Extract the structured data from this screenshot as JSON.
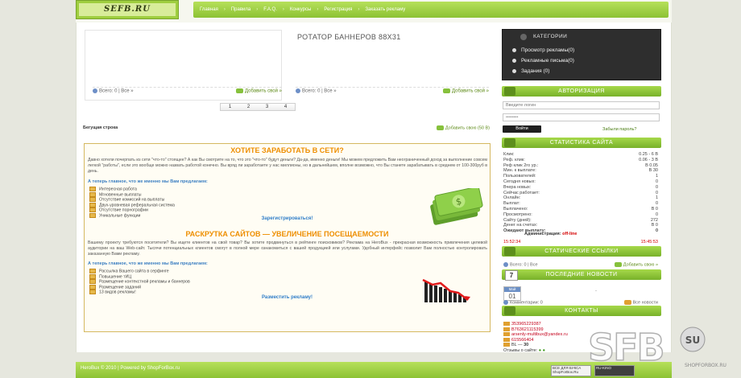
{
  "header": {
    "logo": "SEFB.RU",
    "nav": [
      "Главная",
      "Правила",
      "F.A.Q.",
      "Конкурсы",
      "Регистрация",
      "Заказать рекламу"
    ]
  },
  "banners": {
    "title": "РОТАТОР БАННЕРОВ 88X31",
    "left_count": "Всего: 0 | Все »",
    "left_add": "Добавить свой »",
    "right_count": "Всего: 0 | Все »",
    "right_add": "Добавить свой »",
    "pages": [
      "1",
      "2",
      "3",
      "4"
    ]
  },
  "ticker": {
    "label": "Бегущая строка",
    "add": "Добавить свою (50 В)"
  },
  "offer": {
    "h1": "ХОТИТЕ ЗАРАБОТАТЬ В СЕТИ?",
    "text1": "Давно хотели почерпать из сети \"что-то\" стоящее? А как Вы смотрите на то, что это \"что-то\" будут деньги? Да-да, именно деньги! Мы можем предложить Вам неограниченный доход за выполнение совсем легкой \"работы\", если это вообще можно назвать работой конечно. Вы вряд ли заработаете у нас миллионы, но в дальнейшем, вполне возможно, что Вы станете зарабатывать в среднем от 100-300руб в день.",
    "sub1": "А теперь главное, что же именно мы Вам предлагаем:",
    "list1": [
      "Интересная работа",
      "Мгновенные выплаты",
      "Отсутствие комиссий на выплаты",
      "Двух-уровневая реферальная система",
      "Отсутствие порнографии",
      "Уникальные функции"
    ],
    "cta1": "Зарегистрироваться!",
    "h2": "РАСКРУТКА САЙТОВ — УВЕЛИЧЕНИЕ ПОСЕЩАЕМОСТИ",
    "text2": "Вашему проекту требуются посетители? Вы ищете клиентов на свой товар? Вы хотите продвинуться в рейтинге поисковиков? Реклама на HeroBux - прекрасная возможность привлечения целевой аудитории на ваш Web-сайт. Тысячи потенциальных клиентов смогут в полной мере ознакомиться с вашей продукцией или услугами. Удобный интерфейс позволит Вам полностью контролировать заказанную Вами рекламу.",
    "sub2": "А теперь главное, что же именно мы Вам предлагаем:",
    "list2": [
      "Рассылка Вашего сайта в серфинге",
      "Повышение тИЦ",
      "Размещение контекстной рекламы и баннеров",
      "Размещение заданий",
      "13 видов рекламы!"
    ],
    "cta2": "Разместить рекламу!"
  },
  "sidebar": {
    "categories": {
      "title": "КАТЕГОРИИ",
      "items": [
        "Просмотр рекламы(0)",
        "Рекламные письма(0)",
        "Задания (0)"
      ]
    },
    "auth": {
      "title": "АВТОРИЗАЦИЯ",
      "login_placeholder": "Введите логин",
      "password_value": "••••••••",
      "login_button": "Войти",
      "forgot": "Забыли пароль?"
    },
    "stats": {
      "title": "СТАТИСТИКА САЙТА",
      "rows": [
        {
          "label": "Клик:",
          "value": "0.25 - 6 В"
        },
        {
          "label": "Реф. клик:",
          "value": "0.06 - 3 В"
        },
        {
          "label": "Реф клик 2го ур.:",
          "value": "В 0.05"
        },
        {
          "label": "Мин. к выплате:",
          "value": "В 30"
        },
        {
          "label": "Пользователей:",
          "value": "1"
        },
        {
          "label": "Сегодня новых:",
          "value": "0"
        },
        {
          "label": "Вчера новых:",
          "value": "0"
        },
        {
          "label": "Сейчас работает:",
          "value": "0"
        },
        {
          "label": "Онлайн:",
          "value": "1"
        },
        {
          "label": "Выплат:",
          "value": "0"
        },
        {
          "label": "Выплачено:",
          "value": "В 0"
        },
        {
          "label": "Просмотрено:",
          "value": "0"
        },
        {
          "label": "Сайту (дней):",
          "value": "272"
        },
        {
          "label": "Денег на счетах:",
          "value": "В 0"
        },
        {
          "label": "Ожидают выплату:",
          "value": "0"
        }
      ],
      "admin_label": "Администрация:",
      "admin_status": "off-line",
      "time_left": "15:52:34",
      "time_right": "15:45:53"
    },
    "links": {
      "title": "СТАТИЧЕСКИЕ ССЫЛКИ",
      "count": "Всего: 0 | Все",
      "add": "Добавить свою »"
    },
    "news": {
      "title": "ПОСЛЕДНИЕ НОВОСТИ",
      "cal_day": "7",
      "date_month": "Май",
      "date_day": "01",
      "dash": "-",
      "comments": "Комментарии: 0",
      "all": "Все новости"
    },
    "contacts": {
      "title": "КОНТАКТЫ",
      "items": [
        "353965229387",
        "B763621115399",
        "arsenly-multibux@yandex.ru",
        "615566404"
      ],
      "rating_prefix": "BL",
      "rating_value": "30",
      "feedback": "Отзывы о сайте:"
    }
  },
  "footer": {
    "text": "HeroBux © 2010 | Powered by ShopForBox.ru",
    "counter1": "ВСЕ ДЛЯ БУКСА ShopForBox.Ru",
    "counter2": "RU-KINO"
  },
  "watermark": {
    "main": "SFB",
    "sub": "SU",
    "url": "SHOPFORBOX.RU"
  },
  "colors": {
    "accent": "#8cc234",
    "orange": "#ee8e00",
    "link_blue": "#2f7dc8",
    "red": "#d40000"
  }
}
